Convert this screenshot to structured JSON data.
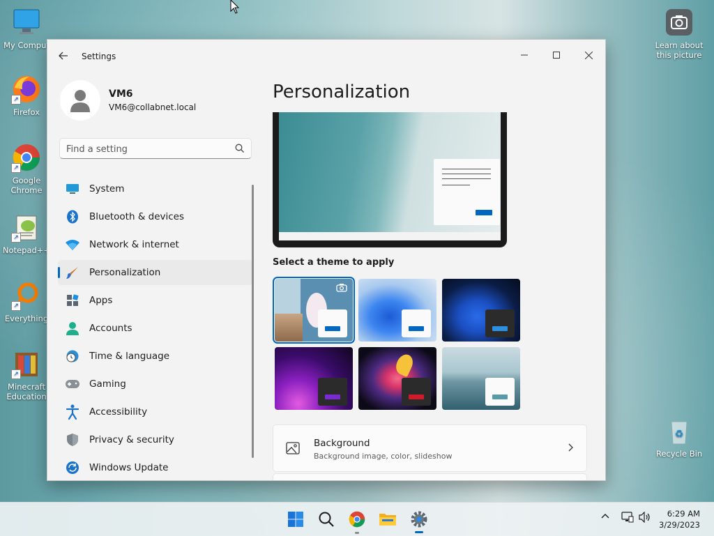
{
  "desktop": {
    "icons": [
      {
        "label": "My Comput",
        "icon": "computer-icon"
      },
      {
        "label": "Firefox",
        "icon": "firefox-icon"
      },
      {
        "label": "Google Chrome",
        "icon": "chrome-icon"
      },
      {
        "label": "Notepad++",
        "icon": "notepad-plus-plus-icon"
      },
      {
        "label": "Everything",
        "icon": "everything-search-icon"
      },
      {
        "label": "Minecraft Education",
        "icon": "minecraft-icon"
      }
    ],
    "right_icons": [
      {
        "label": "Learn about this picture",
        "icon": "camera-icon"
      },
      {
        "label": "Recycle Bin",
        "icon": "recycle-bin-icon"
      }
    ]
  },
  "window": {
    "title": "Settings",
    "profile": {
      "name": "VM6",
      "email": "VM6@collabnet.local"
    },
    "search": {
      "placeholder": "Find a setting"
    },
    "nav": [
      {
        "label": "System",
        "icon": "monitor-icon"
      },
      {
        "label": "Bluetooth & devices",
        "icon": "bluetooth-icon"
      },
      {
        "label": "Network & internet",
        "icon": "wifi-icon"
      },
      {
        "label": "Personalization",
        "icon": "brush-icon",
        "active": true
      },
      {
        "label": "Apps",
        "icon": "apps-icon"
      },
      {
        "label": "Accounts",
        "icon": "person-icon"
      },
      {
        "label": "Time & language",
        "icon": "globe-clock-icon"
      },
      {
        "label": "Gaming",
        "icon": "gamepad-icon"
      },
      {
        "label": "Accessibility",
        "icon": "accessibility-icon"
      },
      {
        "label": "Privacy & security",
        "icon": "shield-icon"
      },
      {
        "label": "Windows Update",
        "icon": "update-icon"
      }
    ],
    "page_title": "Personalization",
    "themes_label": "Select a theme to apply",
    "background_card": {
      "title": "Background",
      "subtitle": "Background image, color, slideshow"
    }
  },
  "taskbar": {
    "time": "6:29 AM",
    "date": "3/29/2023"
  },
  "colors": {
    "accent": "#0067c0"
  }
}
